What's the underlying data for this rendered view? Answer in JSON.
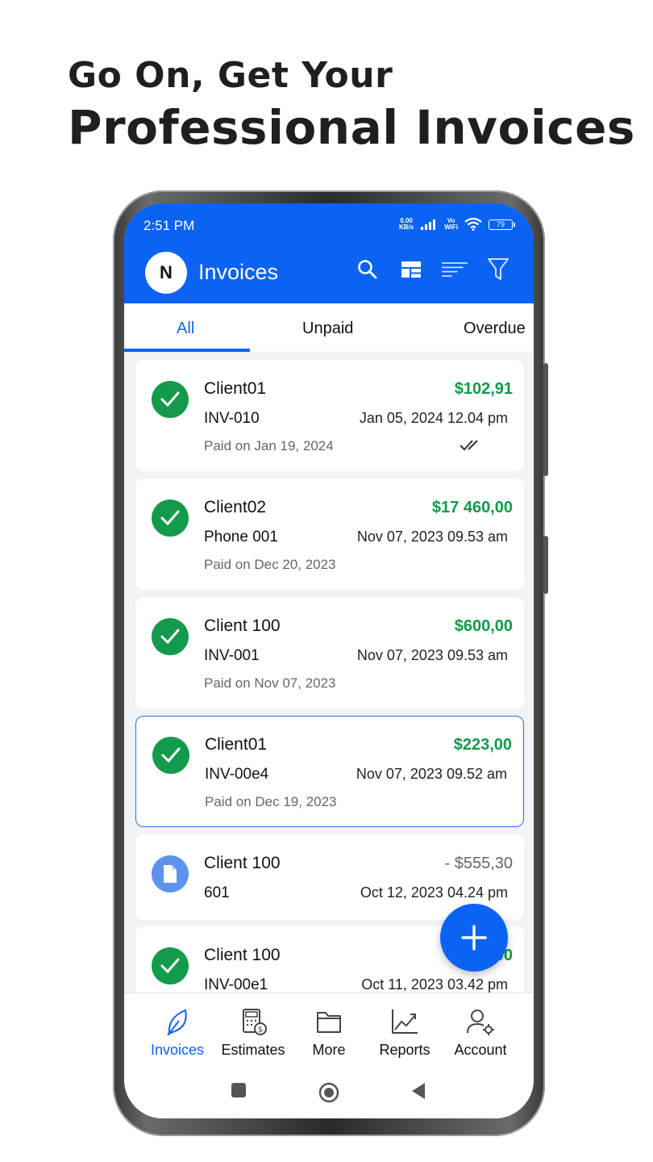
{
  "headline": {
    "line1": "Go On, Get Your",
    "line2": "Professional Invoices"
  },
  "status_bar": {
    "time": "2:51 PM",
    "speed_top": "0.00",
    "speed_unit": "KB/s",
    "vo": "Vo",
    "wifi_label": "WiFi",
    "battery": "79"
  },
  "app_bar": {
    "avatar_letter": "N",
    "title": "Invoices"
  },
  "tabs": [
    {
      "label": "All",
      "active": true
    },
    {
      "label": "Unpaid",
      "active": false
    },
    {
      "label": "Overdue",
      "active": false
    }
  ],
  "invoices": [
    {
      "client": "Client01",
      "amount": "$102,91",
      "number": "INV-010",
      "date": "Jan 05, 2024 12.04 pm",
      "paid_on": "Paid on Jan 19, 2024",
      "status": "paid"
    },
    {
      "client": "Client02",
      "amount": "$17 460,00",
      "number": "Phone 001",
      "date": "Nov 07, 2023 09.53 am",
      "paid_on": "Paid on Dec 20, 2023",
      "status": "paid"
    },
    {
      "client": "Client 100",
      "amount": "$600,00",
      "number": "INV-001",
      "date": "Nov 07, 2023 09.53 am",
      "paid_on": "Paid on Nov 07, 2023",
      "status": "paid"
    },
    {
      "client": "Client01",
      "amount": "$223,00",
      "number": "INV-00e4",
      "date": "Nov 07, 2023 09.52 am",
      "paid_on": "Paid on Dec 19, 2023",
      "status": "paid",
      "selected": true
    },
    {
      "client": "Client 100",
      "amount": "- $555,30",
      "number": "601",
      "date": "Oct 12, 2023 04.24 pm",
      "status": "draft"
    },
    {
      "client": "Client 100",
      "amount": "$1,00",
      "number": "INV-00e1",
      "date": "Oct 11, 2023 03.42 pm",
      "status": "paid"
    }
  ],
  "bottom_nav": [
    {
      "label": "Invoices",
      "icon": "leaf-icon",
      "active": true
    },
    {
      "label": "Estimates",
      "icon": "calculator-icon",
      "active": false
    },
    {
      "label": "More",
      "icon": "folder-icon",
      "active": false
    },
    {
      "label": "Reports",
      "icon": "chart-icon",
      "active": false
    },
    {
      "label": "Account",
      "icon": "user-gear-icon",
      "active": false
    }
  ],
  "colors": {
    "primary": "#0a63f2",
    "paid_green": "#139a4a",
    "draft_blue": "#5d93ec"
  }
}
